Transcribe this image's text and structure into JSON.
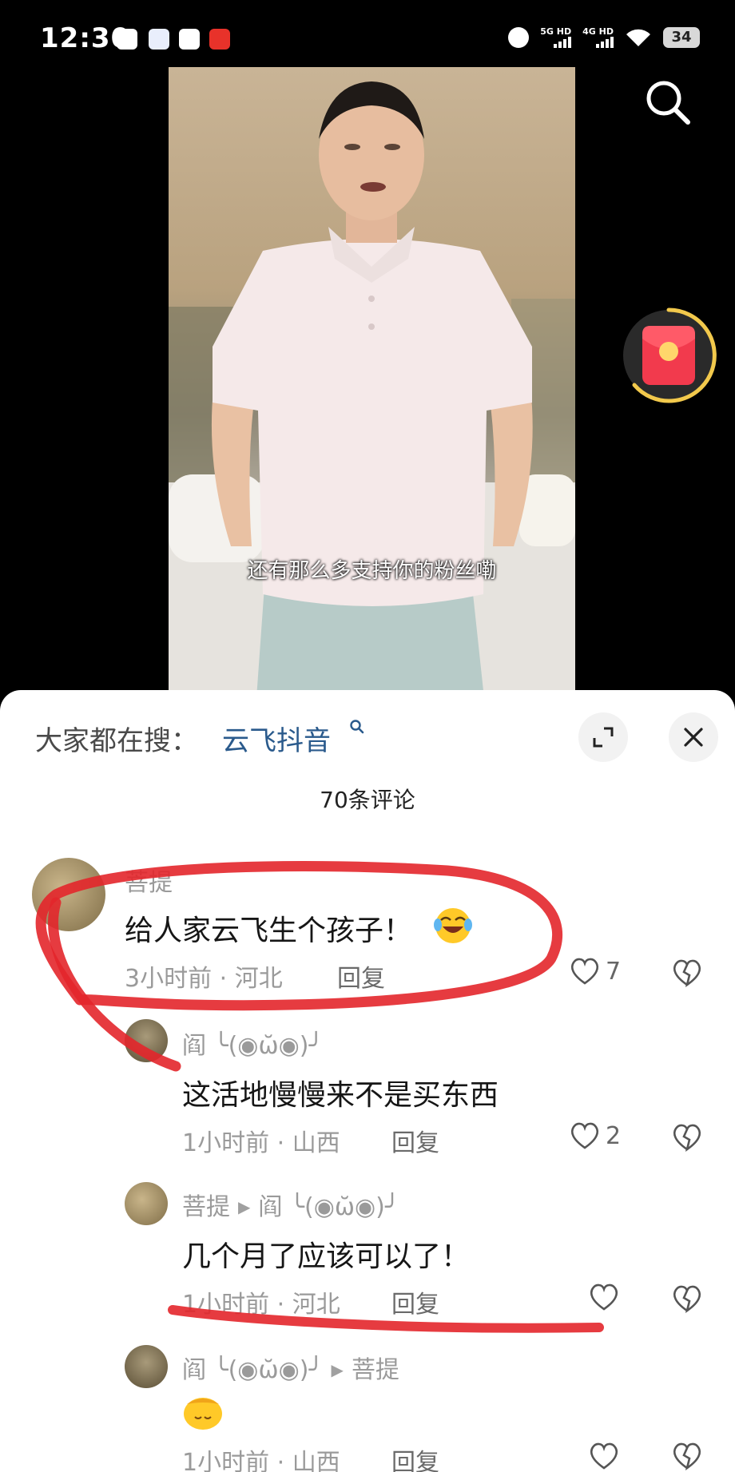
{
  "status_bar": {
    "time": "12:30",
    "network_1": "5G HD",
    "network_2": "4G HD",
    "battery": "34"
  },
  "video": {
    "subtitle": "还有那么多支持你的粉丝嘞"
  },
  "sheet": {
    "search_prefix": "大家都在搜：",
    "search_term": "云飞抖音",
    "comment_count": "70条评论"
  },
  "comments": [
    {
      "author": "菩提",
      "text": "给人家云飞生个孩子！",
      "meta": "3小时前 · 河北",
      "reply": "回复",
      "likes": "7"
    },
    {
      "author": "阎 ╰(◉ω̆◉)╯",
      "text": "这活地慢慢来不是买东西",
      "meta": "1小时前 · 山西",
      "reply": "回复",
      "likes": "2"
    },
    {
      "author": "菩提",
      "reply_to": "阎 ╰(◉ω̆◉)╯",
      "text": "几个月了应该可以了！",
      "meta": "1小时前 · 河北",
      "reply": "回复",
      "likes": ""
    },
    {
      "author": "阎 ╰(◉ω̆◉)╯",
      "reply_to": "菩提",
      "text": "",
      "meta": "1小时前 · 山西",
      "reply": "回复",
      "likes": ""
    }
  ],
  "colors": {
    "search_term": "#2a5a8c",
    "annotation": "#e3262b"
  }
}
